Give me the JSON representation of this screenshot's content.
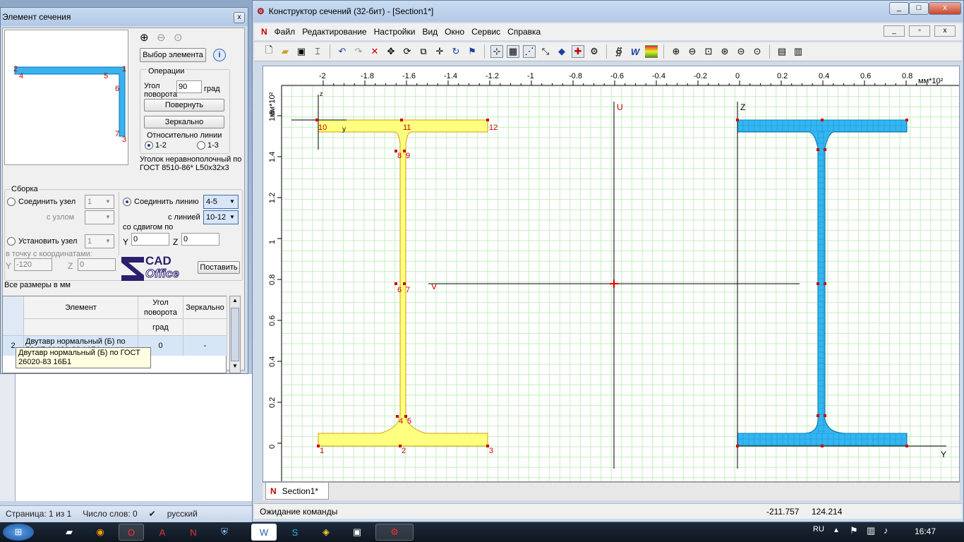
{
  "main_window": {
    "title": "Конструктор сечений (32-бит) - [Section1*]",
    "controls": [
      "_",
      "□",
      "x"
    ],
    "mdi_controls": [
      "_",
      "▫",
      "x"
    ],
    "menu": [
      "Файл",
      "Редактирование",
      "Настройки",
      "Вид",
      "Окно",
      "Сервис",
      "Справка"
    ],
    "status": "Ожидание команды",
    "coord_x": "-211.757",
    "coord_y": "124.214",
    "doc_tab": "Section1*"
  },
  "canvas": {
    "unit_top": "мм*10²",
    "unit_left": "мм*10²",
    "x_ticks": [
      "-2",
      "-1.8",
      "-1.6",
      "-1.4",
      "-1.2",
      "-1",
      "-0.8",
      "-0.6",
      "-0.4",
      "-0.2",
      "0",
      "0.2",
      "0.4",
      "0.6",
      "0.8"
    ],
    "y_ticks": [
      "1.6",
      "1.4",
      "1.2",
      "1",
      "0.8",
      "0.6",
      "0.4",
      "0.2",
      "0"
    ],
    "axis_u": "U",
    "axis_v": "V",
    "axis_z": "Z",
    "axis_y": "Y",
    "axis_z_small": "z",
    "axis_y_small": "y",
    "left_beam_points": [
      "1",
      "2",
      "3",
      "4",
      "5",
      "6",
      "7",
      "8",
      "9",
      "10",
      "11",
      "12"
    ],
    "colors": {
      "left_beam": "#ffff80",
      "right_beam": "#33b6f2",
      "grid": "#b8ecb0",
      "marker": "#c00000"
    }
  },
  "dialog": {
    "title": "Элемент сечения",
    "preview_points": [
      "2",
      "4",
      "5",
      "1",
      "6",
      "7",
      "3"
    ],
    "select_button": "Выбор элемента",
    "info_icon": "i",
    "ops_title": "Операции",
    "angle_label": "Угол поворота",
    "angle_value": "90",
    "angle_unit": "град",
    "rotate_button": "Повернуть",
    "mirror_button": "Зеркально",
    "relative_label": "Относительно линии",
    "radio_12": "1-2",
    "radio_13": "1-3",
    "element_desc": "Уголок неравнополочный по ГОСТ 8510-86* L50x32x3",
    "assembly_title": "Сборка",
    "join_node_label": "Соединить узел",
    "join_node_value": "1",
    "with_node_label": "с узлом",
    "join_line_label": "Соединить линию",
    "join_line_value": "4-5",
    "with_line_label": "с линией",
    "with_line_value": "10-12",
    "shift_label": "со сдвигом по",
    "shift_y_label": "Y",
    "shift_y": "0",
    "shift_z_label": "Z",
    "shift_z": "0",
    "set_node_label": "Установить узел",
    "set_node_value": "1",
    "to_point_label": "в точку с координатами:",
    "coord_y_label": "Y",
    "coord_y": "-120",
    "coord_z_label": "Z",
    "coord_z": "0",
    "logo_top": "CAD",
    "logo_bottom": "Office",
    "place_button": "Поставить",
    "sizes_note": "Все размеры в мм",
    "table": {
      "headers": [
        "Элемент",
        "Угол поворота",
        "Зеркально"
      ],
      "subheader": "град",
      "rows": [
        {
          "num": "2",
          "element": "Двутавр нормальный (Б) по ГОСТ 26020-83 16Б1",
          "angle": "0",
          "mirror": "-"
        }
      ]
    },
    "tooltip": "Двутавр нормальный (Б) по ГОСТ 26020-83 16Б1"
  },
  "word_status": {
    "page": "Страница: 1 из 1",
    "words": "Число слов: 0",
    "lang": "русский"
  },
  "taskbar": {
    "lang": "RU",
    "time": "16:47"
  }
}
